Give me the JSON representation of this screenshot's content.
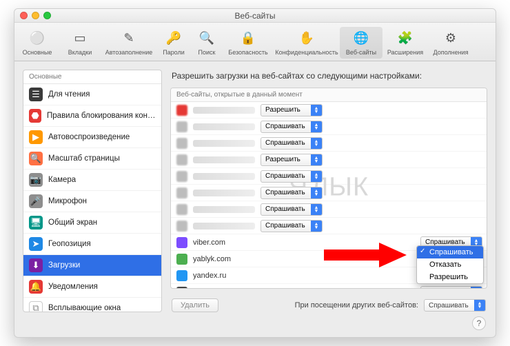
{
  "window": {
    "title": "Веб-сайты"
  },
  "toolbar": {
    "items": [
      {
        "label": "Основные"
      },
      {
        "label": "Вкладки"
      },
      {
        "label": "Автозаполнение"
      },
      {
        "label": "Пароли"
      },
      {
        "label": "Поиск"
      },
      {
        "label": "Безопасность"
      },
      {
        "label": "Конфиденциальность"
      },
      {
        "label": "Веб-сайты"
      },
      {
        "label": "Расширения"
      },
      {
        "label": "Дополнения"
      }
    ],
    "selected_index": 7
  },
  "sidebar": {
    "header": "Основные",
    "items": [
      {
        "label": "Для чтения",
        "icon_bg": "#3a3a3a",
        "glyph": "☰"
      },
      {
        "label": "Правила блокирования контента",
        "icon_bg": "#e53935",
        "glyph": "⬣"
      },
      {
        "label": "Автовоспроизведение",
        "icon_bg": "#ff9800",
        "glyph": "▶"
      },
      {
        "label": "Масштаб страницы",
        "icon_bg": "#ff7043",
        "glyph": "🔍"
      },
      {
        "label": "Камера",
        "icon_bg": "#8e8e8e",
        "glyph": "📷"
      },
      {
        "label": "Микрофон",
        "icon_bg": "#8e8e8e",
        "glyph": "🎤"
      },
      {
        "label": "Общий экран",
        "icon_bg": "#009688",
        "glyph": "🖥"
      },
      {
        "label": "Геопозиция",
        "icon_bg": "#1e88e5",
        "glyph": "➤"
      },
      {
        "label": "Загрузки",
        "icon_bg": "#7b1fa2",
        "glyph": "⬇"
      },
      {
        "label": "Уведомления",
        "icon_bg": "#e53935",
        "glyph": "🔔"
      },
      {
        "label": "Всплывающие окна",
        "icon_bg": "#ffffff",
        "glyph": "⧉"
      }
    ],
    "selected_index": 8
  },
  "main": {
    "heading": "Разрешить загрузки на веб-сайтах со следующими настройками:",
    "list_header": "Веб-сайты, открытые в данный момент",
    "rows": [
      {
        "label": "",
        "blur": true,
        "select": "Разрешить",
        "icon_bg": "#e53935"
      },
      {
        "label": "",
        "blur": true,
        "select": "Спрашивать",
        "icon_bg": "#bdbdbd"
      },
      {
        "label": "",
        "blur": true,
        "select": "Спрашивать",
        "icon_bg": "#bdbdbd"
      },
      {
        "label": "",
        "blur": true,
        "select": "Разрешить",
        "icon_bg": "#bdbdbd"
      },
      {
        "label": "",
        "blur": true,
        "select": "Спрашивать",
        "icon_bg": "#bdbdbd"
      },
      {
        "label": "",
        "blur": true,
        "select": "Спрашивать",
        "icon_bg": "#bdbdbd"
      },
      {
        "label": "",
        "blur": true,
        "select": "Спрашивать",
        "icon_bg": "#bdbdbd"
      },
      {
        "label": "",
        "blur": true,
        "select": "Спрашивать",
        "icon_bg": "#bdbdbd"
      },
      {
        "label": "viber.com",
        "blur": false,
        "select": "Спрашивать",
        "icon_bg": "#7c4dff"
      },
      {
        "label": "yablyk.com",
        "blur": false,
        "select": "",
        "icon_bg": "#4caf50"
      },
      {
        "label": "yandex.ru",
        "blur": false,
        "select": "Спрашивать",
        "icon_bg": "#2196f3"
      },
      {
        "label": "zen.yandex.ru",
        "blur": false,
        "select": "Спрашивать",
        "icon_bg": "#424242"
      }
    ],
    "dropdown": {
      "options": [
        {
          "label": "Спрашивать",
          "checked": true,
          "selected": true
        },
        {
          "label": "Отказать",
          "checked": false,
          "selected": false
        },
        {
          "label": "Разрешить",
          "checked": false,
          "selected": false
        }
      ],
      "target_row_index": 9
    },
    "delete_label": "Удалить",
    "footer_label": "При посещении других веб-сайтов:",
    "footer_select": "Спрашивать"
  },
  "watermark": {
    "left": "Я",
    "right": "ЛЫК"
  }
}
